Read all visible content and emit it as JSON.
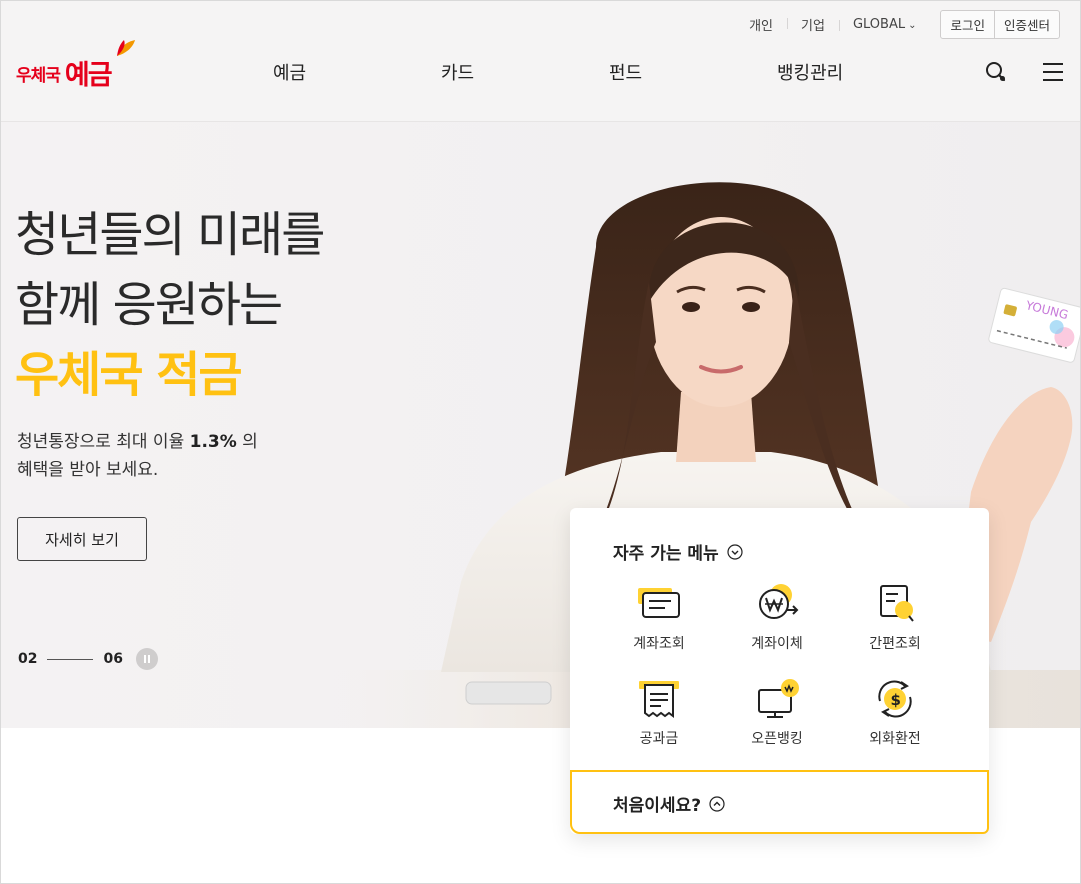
{
  "brand": {
    "logo_sub": "우체국",
    "logo_main": "예금",
    "logo_color": "#e5001b"
  },
  "utility": {
    "items": [
      "개인",
      "기업",
      "GLOBAL"
    ],
    "login": "로그인",
    "certificate": "인증센터"
  },
  "nav": {
    "items": [
      "예금",
      "카드",
      "펀드",
      "뱅킹관리"
    ],
    "icons": [
      "search-icon",
      "menu-icon"
    ]
  },
  "hero": {
    "title_line1": "청년들의 미래를",
    "title_line2": "함께 응원하는",
    "title_accent": "우체국 적금",
    "desc_part1": "청년통장으로 최대 이율 ",
    "desc_rate": "1.3%",
    "desc_part2": " 의",
    "desc_line2": "혜택을 받아 보세요.",
    "button": "자세히 보기",
    "accent_color": "#ffc112",
    "pager": {
      "current": "02",
      "total": "06"
    }
  },
  "quick_menu": {
    "title": "자주 가는 메뉴",
    "items": [
      {
        "label": "계좌조회",
        "icon": "account-inquiry-icon"
      },
      {
        "label": "계좌이체",
        "icon": "transfer-icon"
      },
      {
        "label": "간편조회",
        "icon": "quick-inquiry-icon"
      },
      {
        "label": "공과금",
        "icon": "utility-bill-icon"
      },
      {
        "label": "오픈뱅킹",
        "icon": "open-banking-icon"
      },
      {
        "label": "외화환전",
        "icon": "currency-exchange-icon"
      }
    ],
    "first_time": "처음이세요?"
  }
}
